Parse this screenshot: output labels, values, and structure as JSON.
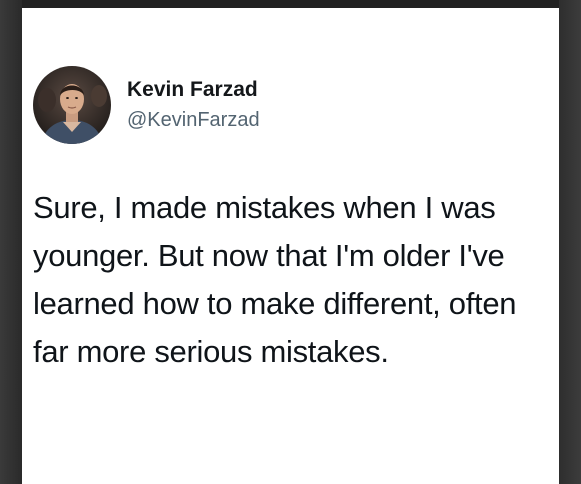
{
  "tweet": {
    "author": {
      "name": "Kevin Farzad",
      "handle": "@KevinFarzad",
      "avatar_icon": "profile-photo-icon"
    },
    "text_lines": [
      "Sure, I made mistakes when I was",
      "younger. But now that I'm older I've",
      "learned how to make different, often",
      "far more serious mistakes."
    ]
  },
  "colors": {
    "name": "#14171a",
    "handle": "#536471",
    "body_text": "#0f1419",
    "card_background": "#ffffff",
    "surround": "#2b2b2b"
  }
}
